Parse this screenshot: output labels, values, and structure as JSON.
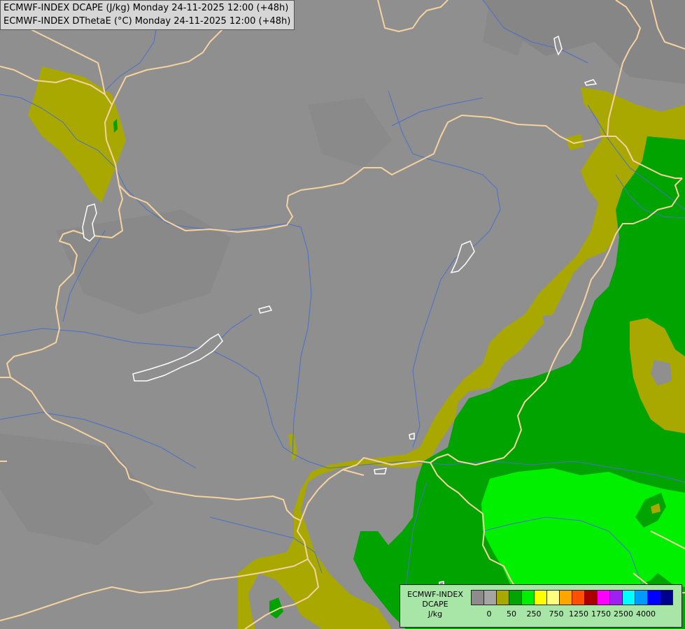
{
  "titles": [
    "ECMWF-INDEX DCAPE (J/kg) Monday 24-11-2025 12:00 (+48h)",
    "ECMWF-INDEX DThetaE (°C) Monday 24-11-2025 12:00 (+48h)"
  ],
  "legend": {
    "name_lines": [
      "ECMWF-INDEX",
      "DCAPE",
      "J/kg"
    ],
    "swatches": [
      "#8c8c8c",
      "#a5a5a5",
      "#a8a800",
      "#00a300",
      "#00f000",
      "#ffff00",
      "#ffff80",
      "#ffa500",
      "#ff5000",
      "#aa0000",
      "#ff00ff",
      "#a020f0",
      "#00ffff",
      "#0099ff",
      "#0000ff",
      "#000090"
    ],
    "ticks": [
      "0",
      "50",
      "250",
      "750",
      "1250",
      "1750",
      "2500",
      "4000"
    ]
  },
  "colors": {
    "background": "#8f8f8f",
    "shade_50_250": "#a8a800",
    "shade_250_500": "#00a300",
    "shade_500_750": "#00f000",
    "borders": "#f5d2a0",
    "rivers": "#4a70c8",
    "lakes": "#ffffff"
  }
}
